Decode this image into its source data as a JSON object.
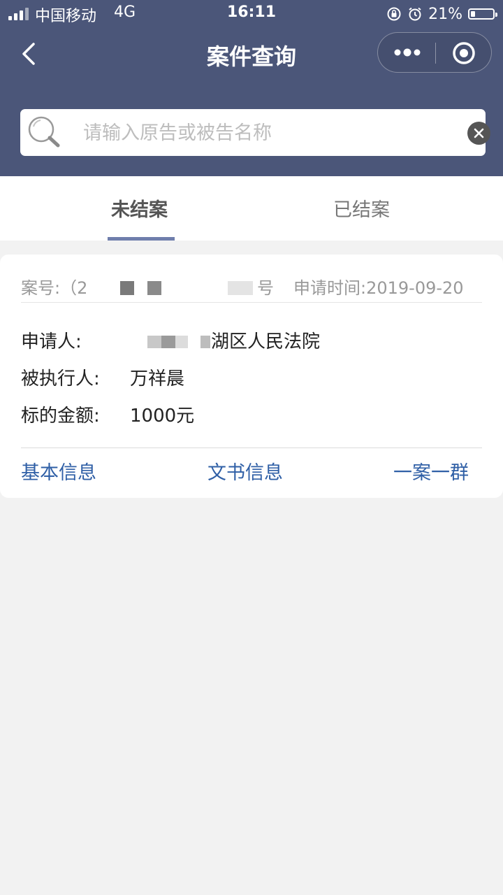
{
  "status_bar": {
    "carrier": "中国移动",
    "network": "4G",
    "time": "16:11",
    "battery_percent_label": "21%",
    "battery_level": 0.21,
    "icons": [
      "signal-icon",
      "rotation-lock-icon",
      "alarm-icon",
      "battery-icon"
    ]
  },
  "navbar": {
    "title": "案件查询",
    "icons": [
      "back-icon",
      "more-icon",
      "target-icon"
    ]
  },
  "search": {
    "placeholder": "请输入原告或被告名称",
    "value": "",
    "icons": [
      "search-icon",
      "clear-icon"
    ]
  },
  "tabs": [
    {
      "label": "未结案",
      "active": true
    },
    {
      "label": "已结案",
      "active": false
    }
  ],
  "case_card": {
    "case_no_prefix": "案号:（2",
    "case_no_suffix": "号",
    "apply_time": "申请时间:2019-09-20",
    "applicant_label": "申请人:",
    "applicant_value": "湖区人民法院",
    "respondent_label": "被执行人:",
    "respondent_value": "万祥晨",
    "amount_label": "标的金额:",
    "amount_value": "1000元",
    "actions": [
      "基本信息",
      "文书信息",
      "一案一群"
    ]
  },
  "colors": {
    "header_bg": "#4b5679",
    "tab_indicator": "#6f7eac",
    "action_link": "#2f5fa6",
    "page_bg": "#f2f2f2"
  }
}
